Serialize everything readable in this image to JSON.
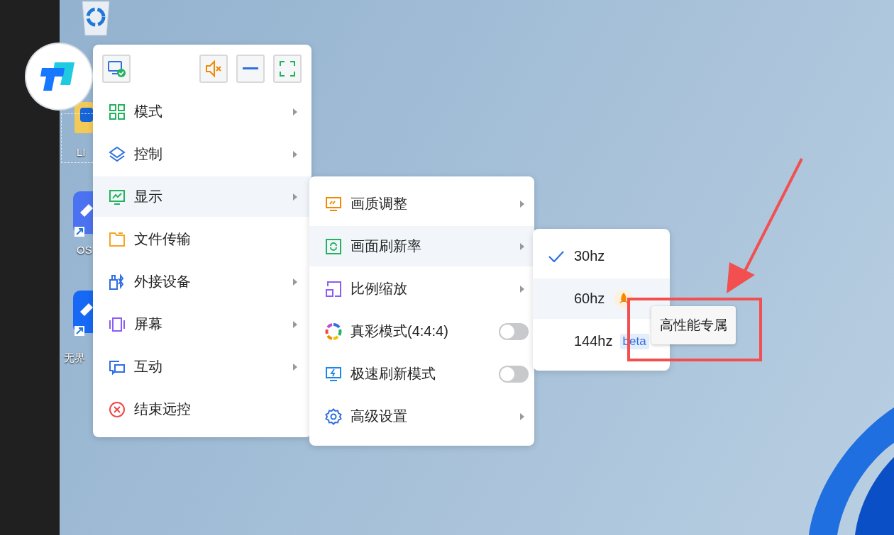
{
  "desktop_icons": [
    {
      "kind": "recycle"
    },
    {
      "kind": "folder",
      "label": "LI"
    },
    {
      "kind": "app",
      "label": "OS"
    },
    {
      "kind": "app",
      "label": "无界"
    }
  ],
  "main_menu": {
    "items": [
      {
        "label": "模式",
        "submenu": true,
        "selected": false
      },
      {
        "label": "控制",
        "submenu": true,
        "selected": false
      },
      {
        "label": "显示",
        "submenu": true,
        "selected": true
      },
      {
        "label": "文件传输",
        "submenu": false,
        "selected": false
      },
      {
        "label": "外接设备",
        "submenu": true,
        "selected": false
      },
      {
        "label": "屏幕",
        "submenu": true,
        "selected": false
      },
      {
        "label": "互动",
        "submenu": true,
        "selected": false
      },
      {
        "label": "结束远控",
        "submenu": false,
        "selected": false
      }
    ]
  },
  "display_menu": {
    "items": [
      {
        "kind": "submenu",
        "label": "画质调整",
        "selected": false
      },
      {
        "kind": "submenu",
        "label": "画面刷新率",
        "selected": true
      },
      {
        "kind": "submenu",
        "label": "比例缩放",
        "selected": false
      },
      {
        "kind": "toggle",
        "label": "真彩模式(4:4:4)",
        "on": false,
        "selected": false
      },
      {
        "kind": "toggle",
        "label": "极速刷新模式",
        "on": false,
        "selected": false
      },
      {
        "kind": "submenu",
        "label": "高级设置",
        "selected": false
      }
    ]
  },
  "refresh_menu": {
    "items": [
      {
        "label": "30hz",
        "checked": true,
        "selected": false,
        "premium": false
      },
      {
        "label": "60hz",
        "checked": false,
        "selected": true,
        "premium": true
      },
      {
        "label": "144hz",
        "checked": false,
        "selected": false,
        "premium": false,
        "tag": "beta"
      }
    ]
  },
  "tooltip": {
    "text": "高性能专属"
  }
}
